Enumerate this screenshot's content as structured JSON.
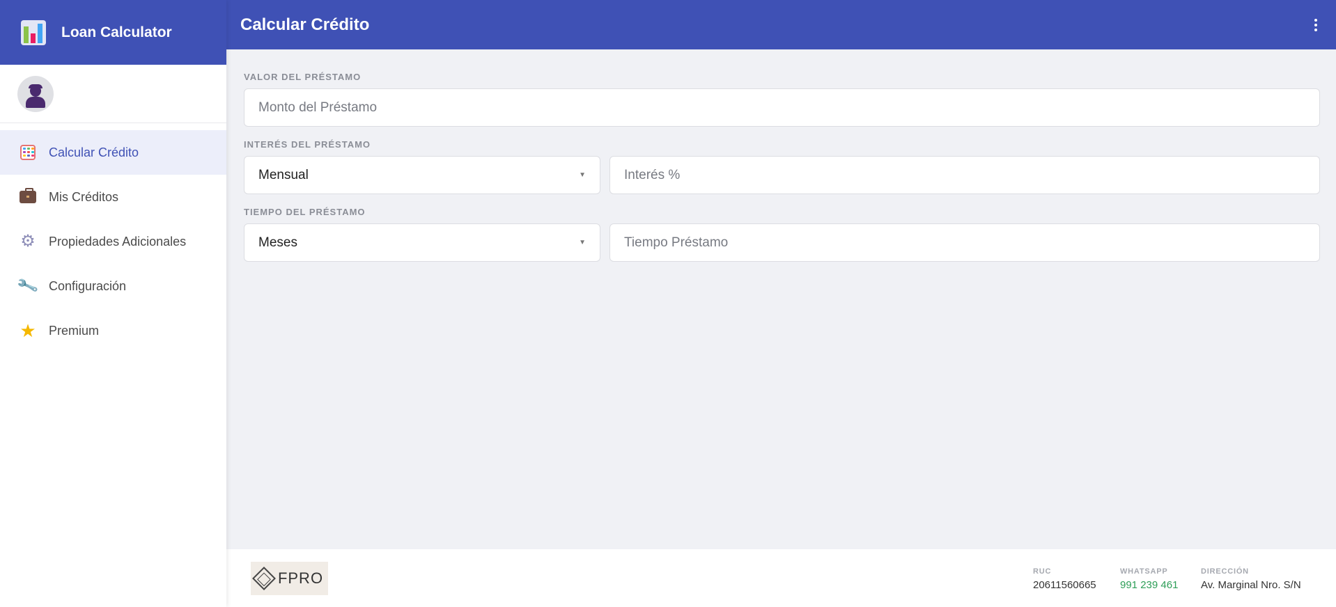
{
  "app": {
    "title": "Loan Calculator"
  },
  "header": {
    "title": "Calcular Crédito"
  },
  "sidebar": {
    "items": [
      {
        "label": "Calcular Crédito",
        "icon": "calculator-icon",
        "active": true
      },
      {
        "label": "Mis Créditos",
        "icon": "briefcase-icon",
        "active": false
      },
      {
        "label": "Propiedades Adicionales",
        "icon": "gear-icon",
        "active": false
      },
      {
        "label": "Configuración",
        "icon": "wrench-icon",
        "active": false
      },
      {
        "label": "Premium",
        "icon": "star-icon",
        "active": false
      }
    ]
  },
  "form": {
    "amount": {
      "label": "VALOR DEL PRÉSTAMO",
      "placeholder": "Monto del Préstamo",
      "value": ""
    },
    "interest": {
      "label": "INTERÉS DEL PRÉSTAMO",
      "period": "Mensual",
      "placeholder": "Interés %",
      "value": ""
    },
    "term": {
      "label": "TIEMPO DEL PRÉSTAMO",
      "unit": "Meses",
      "placeholder": "Tiempo Préstamo",
      "value": ""
    }
  },
  "footer": {
    "logo": "FPRO",
    "ruc": {
      "label": "RUC",
      "value": "20611560665"
    },
    "whatsapp": {
      "label": "WHATSAPP",
      "value": "991 239 461"
    },
    "address": {
      "label": "DIRECCIÓN",
      "value": "Av. Marginal Nro. S/N"
    }
  },
  "colors": {
    "primary": "#3f51b5",
    "active_bg": "#eceefa",
    "whatsapp": "#2e9e58"
  }
}
